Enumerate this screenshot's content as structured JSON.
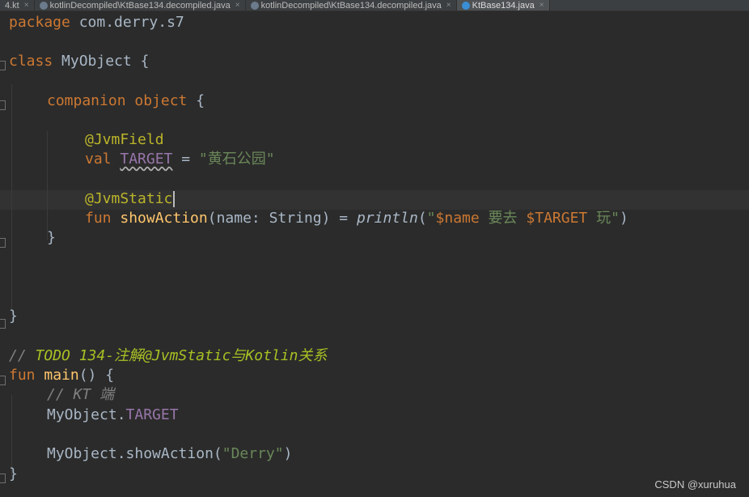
{
  "tabs": [
    {
      "label": "4.kt",
      "icon": "kotlin-file-icon",
      "active": false
    },
    {
      "label": "kotlinDecompiled\\KtBase134.decompiled.java",
      "icon": "java-file-icon",
      "active": false
    },
    {
      "label": "kotlinDecompiled\\KtBase134.decompiled.java",
      "icon": "java-file-icon",
      "active": false
    },
    {
      "label": "KtBase134.java",
      "icon": "java-class-icon",
      "active": true
    }
  ],
  "code": {
    "l1": {
      "kw": "package",
      "rest": " com.derry.s7"
    },
    "l2": {
      "kw": "class",
      "name": "MyObject",
      "brace": " {"
    },
    "l3": {
      "kw": "companion object",
      "brace": " {"
    },
    "l4": {
      "ann": "@JvmField"
    },
    "l5": {
      "kw": "val",
      "prop": "TARGET",
      "eq": " = ",
      "str": "\"黄石公园\""
    },
    "l6": {
      "ann": "@JvmStatic"
    },
    "l7": {
      "kw": "fun",
      "fn": "showAction",
      "params": "(name: String) = ",
      "call": "println",
      "open": "(",
      "q1": "\"",
      "t1": "$name",
      "t2": " 要去 ",
      "t3": "$TARGET",
      "t4": " 玩",
      "q2": "\"",
      "close": ")"
    },
    "l8": {
      "brace": "}"
    },
    "l9": {
      "brace": "}"
    },
    "l10": {
      "comment": "// ",
      "todo": "TODO 134-注解@JvmStatic与Kotlin关系"
    },
    "l11": {
      "kw": "fun",
      "fn": "main",
      "rest": "() {"
    },
    "l12": {
      "comment": "// KT 端"
    },
    "l13": {
      "obj": "MyObject.",
      "prop": "TARGET"
    },
    "l14": {
      "call": "MyObject.showAction(",
      "str": "\"Derry\"",
      "close": ")"
    },
    "l15": {
      "brace": "}"
    }
  },
  "watermark": "CSDN @xuruhua"
}
